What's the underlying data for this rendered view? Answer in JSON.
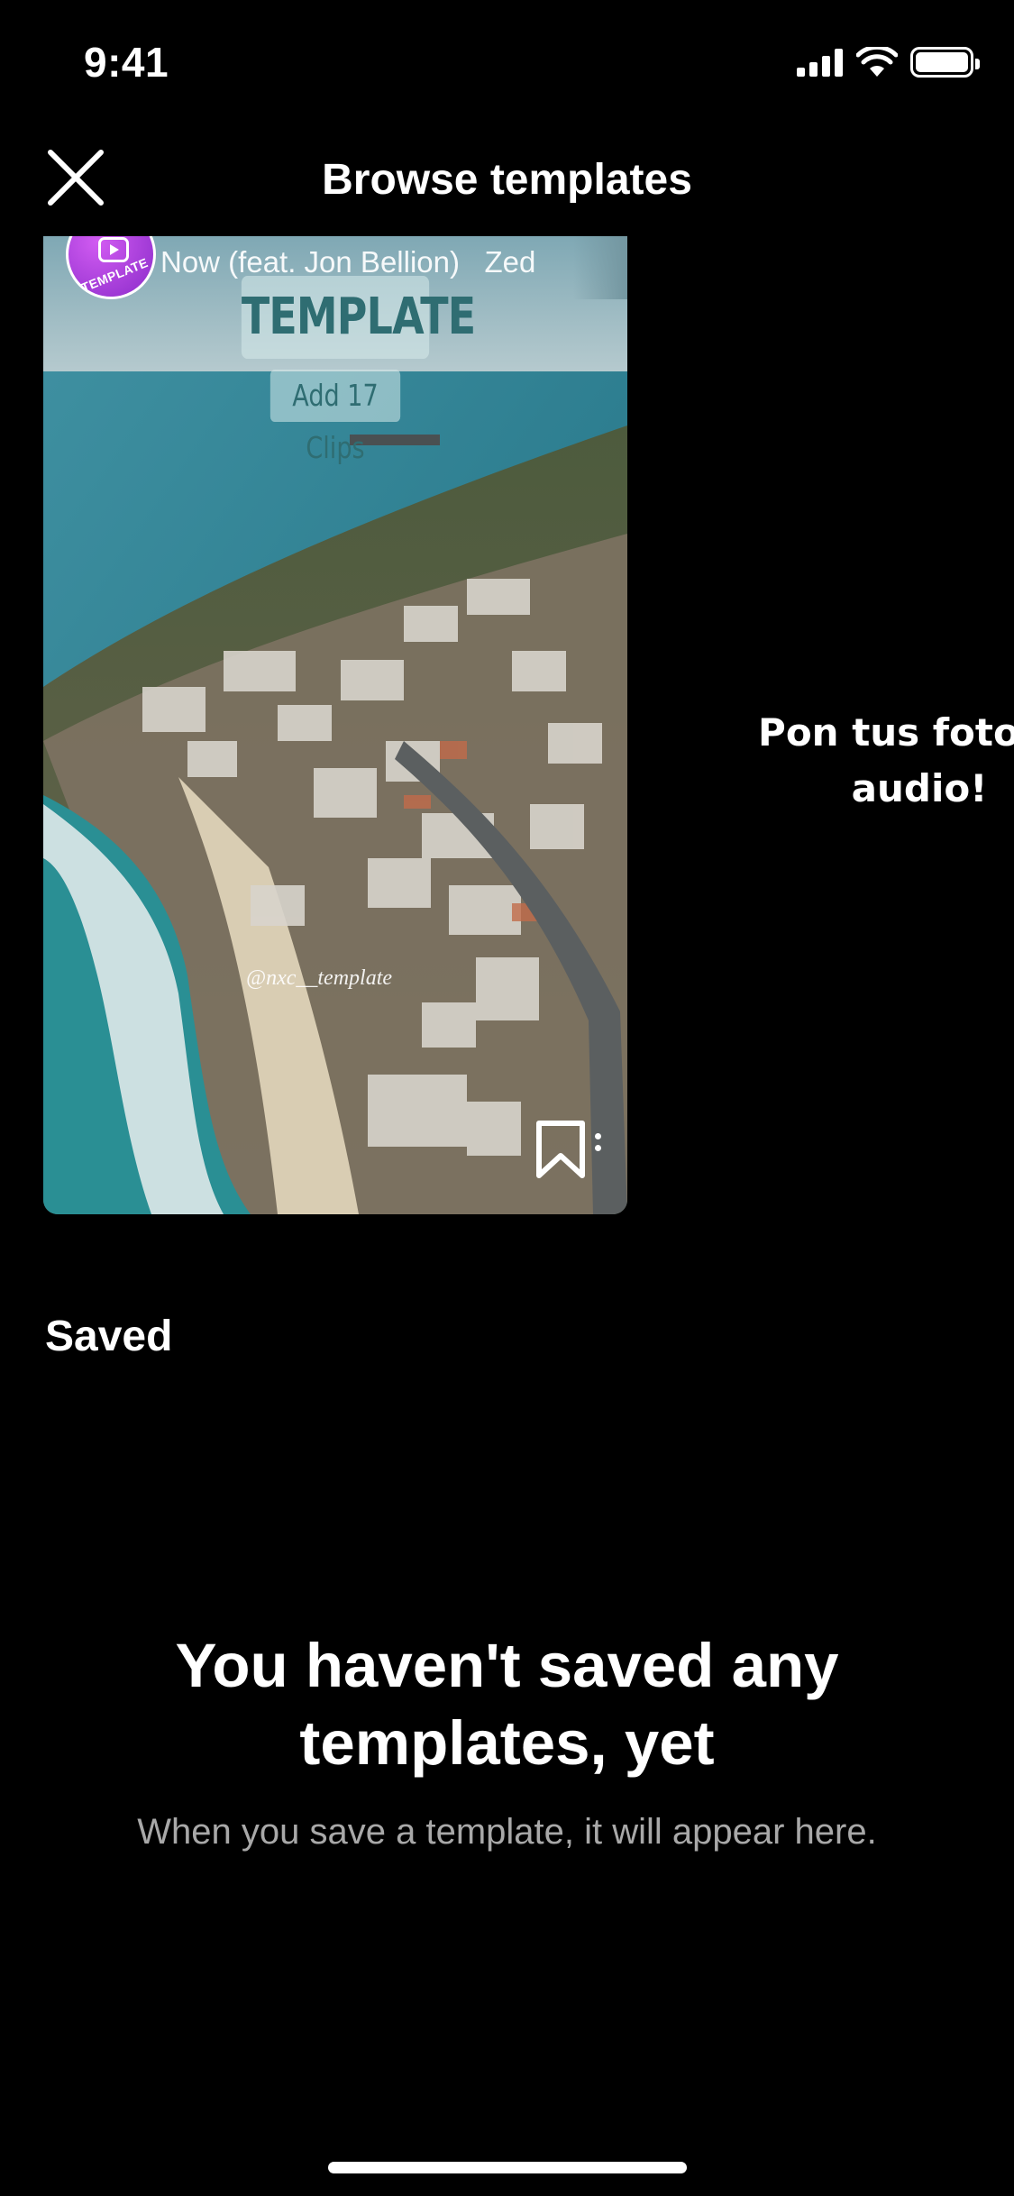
{
  "status_bar": {
    "time": "9:41",
    "icons": [
      "signal-icon",
      "wifi-icon",
      "battery-icon"
    ]
  },
  "header": {
    "title": "Browse templates",
    "close_icon": "close-icon"
  },
  "carousel": {
    "cards": [
      {
        "song": "Now (feat. Jon Bellion)",
        "artist_fragment": "Zed",
        "badge_label": "TEMPLATE",
        "template_label": "TEMPLATE",
        "clips_label": "Add 17 Clips",
        "watermark": "@nxc__template",
        "save_icon": "bookmark-icon"
      }
    ],
    "next_card_text": [
      "Pon tus fotos e",
      "audio!"
    ]
  },
  "saved": {
    "section_title": "Saved",
    "empty_heading": "You haven't saved any templates, yet",
    "empty_subtext": "When you save a template, it will appear here."
  },
  "colors": {
    "background": "#000000",
    "text": "#ffffff",
    "subtext": "#a8a8a8",
    "badge": "#b24ae0",
    "template_text": "#2f6d72"
  }
}
